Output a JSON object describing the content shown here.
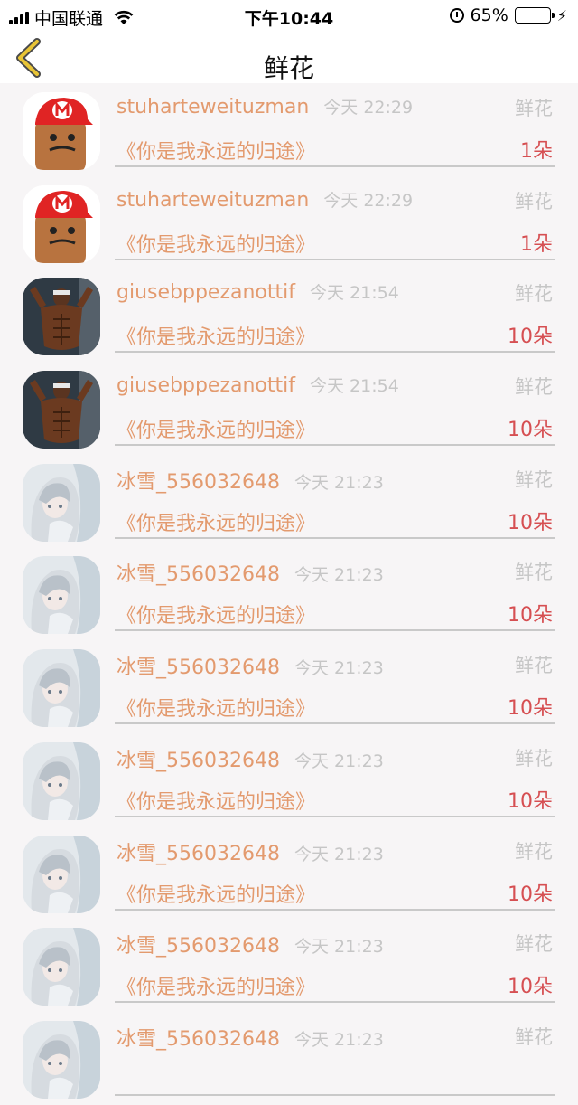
{
  "status_bar": {
    "carrier": "中国联通",
    "time": "下午10:44",
    "battery_percent": "65%",
    "battery_level": 0.65
  },
  "header": {
    "title": "鲜花"
  },
  "rows": [
    {
      "avatar": "red-cap-cartoon",
      "user": "stuharteweituzman",
      "time": "今天 22:29",
      "type": "鲜花",
      "song": "《你是我永远的归途》",
      "qty": "1朵"
    },
    {
      "avatar": "red-cap-cartoon",
      "user": "stuharteweituzman",
      "time": "今天 22:29",
      "type": "鲜花",
      "song": "《你是我永远的归途》",
      "qty": "1朵"
    },
    {
      "avatar": "muscle-man",
      "user": "giusebppezanottif",
      "time": "今天 21:54",
      "type": "鲜花",
      "song": "《你是我永远的归途》",
      "qty": "10朵"
    },
    {
      "avatar": "muscle-man",
      "user": "giusebppezanottif",
      "time": "今天 21:54",
      "type": "鲜花",
      "song": "《你是我永远的归途》",
      "qty": "10朵"
    },
    {
      "avatar": "anime-girl",
      "user": "冰雪_556032648",
      "time": "今天 21:23",
      "type": "鲜花",
      "song": "《你是我永远的归途》",
      "qty": "10朵"
    },
    {
      "avatar": "anime-girl",
      "user": "冰雪_556032648",
      "time": "今天 21:23",
      "type": "鲜花",
      "song": "《你是我永远的归途》",
      "qty": "10朵"
    },
    {
      "avatar": "anime-girl",
      "user": "冰雪_556032648",
      "time": "今天 21:23",
      "type": "鲜花",
      "song": "《你是我永远的归途》",
      "qty": "10朵"
    },
    {
      "avatar": "anime-girl",
      "user": "冰雪_556032648",
      "time": "今天 21:23",
      "type": "鲜花",
      "song": "《你是我永远的归途》",
      "qty": "10朵"
    },
    {
      "avatar": "anime-girl",
      "user": "冰雪_556032648",
      "time": "今天 21:23",
      "type": "鲜花",
      "song": "《你是我永远的归途》",
      "qty": "10朵"
    },
    {
      "avatar": "anime-girl",
      "user": "冰雪_556032648",
      "time": "今天 21:23",
      "type": "鲜花",
      "song": "《你是我永远的归途》",
      "qty": "10朵"
    },
    {
      "avatar": "anime-girl",
      "user": "冰雪_556032648",
      "time": "今天 21:23",
      "type": "鲜花",
      "song": "",
      "qty": ""
    }
  ],
  "colors": {
    "accent": "#e39a6e",
    "quantity": "#d64f52",
    "back_arrow": "#e8c436"
  }
}
